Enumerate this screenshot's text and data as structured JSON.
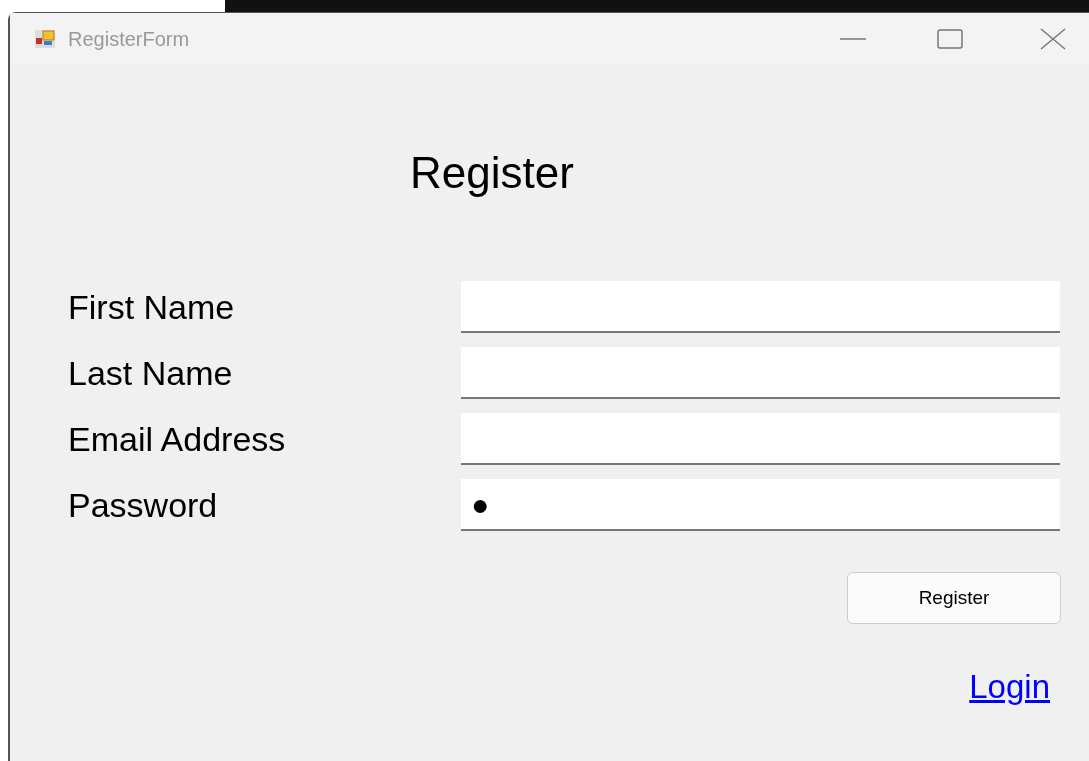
{
  "window": {
    "title": "RegisterForm"
  },
  "heading": "Register",
  "fields": [
    {
      "label": "First Name"
    },
    {
      "label": "Last Name"
    },
    {
      "label": "Email Address"
    },
    {
      "label": "Password",
      "value": "●"
    }
  ],
  "button": "Register",
  "link": "Login"
}
